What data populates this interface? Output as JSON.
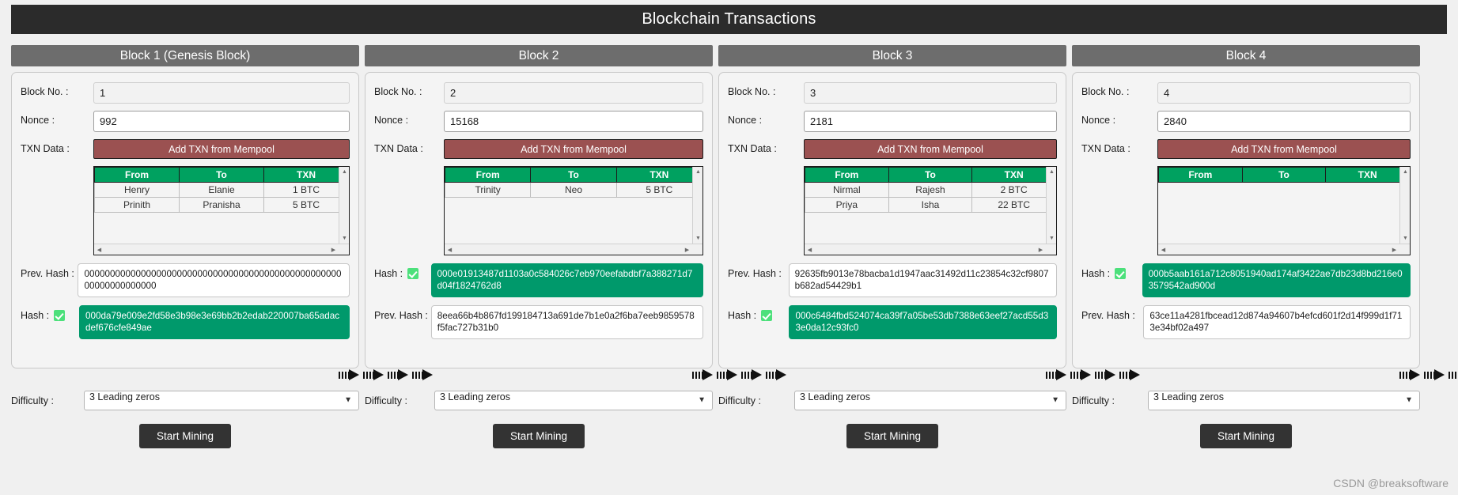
{
  "app": {
    "title": "Blockchain Transactions",
    "watermark": "CSDN @breaksoftware"
  },
  "labels": {
    "block_no": "Block No. :",
    "nonce": "Nonce :",
    "txn_data": "TXN Data :",
    "prev_hash": "Prev. Hash :",
    "hash": "Hash :",
    "difficulty": "Difficulty :",
    "mempool_button": "Add TXN from Mempool",
    "mine_button": "Start Mining",
    "txn_headers": [
      "From",
      "To",
      "TXN"
    ]
  },
  "blocks": [
    {
      "header": "Block 1 (Genesis Block)",
      "block_no": "1",
      "nonce": "992",
      "transactions": [
        {
          "from": "Henry",
          "to": "Elanie",
          "txn": "1 BTC"
        },
        {
          "from": "Prinith",
          "to": "Pranisha",
          "txn": "5 BTC"
        }
      ],
      "order": "prev_then_hash",
      "prev_hash": "0000000000000000000000000000000000000000000000000000000000000000",
      "hash": "000da79e009e2fd58e3b98e3e69bb2b2edab220007ba65adacdef676cfe849ae",
      "hash_valid": true,
      "difficulty": "3 Leading zeros"
    },
    {
      "header": "Block 2",
      "block_no": "2",
      "nonce": "15168",
      "transactions": [
        {
          "from": "Trinity",
          "to": "Neo",
          "txn": "5 BTC"
        }
      ],
      "order": "hash_then_prev",
      "prev_hash": "8eea66b4b867fd199184713a691de7b1e0a2f6ba7eeb9859578f5fac727b31b0",
      "hash": "000e01913487d1103a0c584026c7eb970eefabdbf7a388271d7d04f1824762d8",
      "hash_valid": true,
      "difficulty": "3 Leading zeros"
    },
    {
      "header": "Block 3",
      "block_no": "3",
      "nonce": "2181",
      "transactions": [
        {
          "from": "Nirmal",
          "to": "Rajesh",
          "txn": "2 BTC"
        },
        {
          "from": "Priya",
          "to": "Isha",
          "txn": "22 BTC"
        }
      ],
      "order": "prev_then_hash",
      "prev_hash": "92635fb9013e78bacba1d1947aac31492d11c23854c32cf9807b682ad54429b1",
      "hash": "000c6484fbd524074ca39f7a05be53db7388e63eef27acd55d33e0da12c93fc0",
      "hash_valid": true,
      "difficulty": "3 Leading zeros"
    },
    {
      "header": "Block 4",
      "block_no": "4",
      "nonce": "2840",
      "transactions": [],
      "order": "hash_then_prev",
      "prev_hash": "63ce11a4281fbcead12d874a94607b4efcd601f2d14f999d1f713e34bf02a497",
      "hash": "000b5aab161a712c8051940ad174af3422ae7db23d8bd216e03579542ad900d",
      "hash_valid": true,
      "difficulty": "3 Leading zeros"
    }
  ],
  "colors": {
    "titlebar_bg": "#2b2b2b",
    "block_header_bg": "#6d6d6d",
    "mempool_btn_bg": "#9b5151",
    "txn_header_bg": "#00a160",
    "valid_hash_bg": "#00996b",
    "mine_btn_bg": "#333333",
    "check_badge": "#4ce07b"
  }
}
